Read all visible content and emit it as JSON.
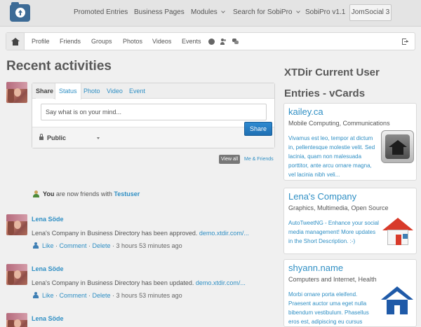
{
  "topnav": {
    "items": [
      "Promoted Entries",
      "Business Pages",
      "Modules",
      "Search for SobiPro",
      "SobiPro v1.1",
      "JomSocial 3"
    ]
  },
  "subnav": {
    "items": [
      "Profile",
      "Friends",
      "Groups",
      "Photos",
      "Videos",
      "Events"
    ]
  },
  "activity": {
    "title": "Recent activities",
    "share": {
      "tabs": [
        "Share",
        "Status",
        "Photo",
        "Video",
        "Event"
      ],
      "placeholder": "Say what is on your mind...",
      "privacy": "Public",
      "button": "Share"
    },
    "filters": {
      "view_all": "View all",
      "me_friends": "Me & Friends"
    },
    "friend_notice": {
      "you": "You",
      "text": "are now friends with",
      "name": "Testuser"
    },
    "entries": [
      {
        "name": "Lena Söde",
        "text": "Lena's Company in Business Directory has been approved.",
        "link": "demo.xtdir.com/...",
        "like": "Like",
        "comment": "Comment",
        "delete": "Delete",
        "time": "3 hours 53 minutes ago"
      },
      {
        "name": "Lena Söde",
        "text": "Lena's Company in Business Directory has been updated.",
        "link": "demo.xtdir.com/...",
        "like": "Like",
        "comment": "Comment",
        "delete": "Delete",
        "time": "3 hours 53 minutes ago"
      },
      {
        "name": "Lena Söde"
      }
    ]
  },
  "sidebar": {
    "title": "XTDir Current User Entries - vCards",
    "cards": [
      {
        "name": "kailey.ca",
        "cats": "Mobile Computing, Communications",
        "desc": "Vivamus est leo, tempor at dictum in, pellentesque molestie velit. Sed lacinia, quam non malesuada porttitor, ante arcu ornare magna, vel lacinia nibh veli..."
      },
      {
        "name": "Lena's Company",
        "cats": "Graphics, Multimedia, Open Source",
        "desc": "AutoTweetNG - Enhance your social media management! More updates in the Short Description. :-)"
      },
      {
        "name": "shyann.name",
        "cats": "Computers and Internet, Health",
        "desc": "Morbi ornare porta eleifend. Praesent auctor uma eget nulla bibendum vestibulum. Phasellus eros est, adipiscing eu cursus"
      }
    ]
  }
}
